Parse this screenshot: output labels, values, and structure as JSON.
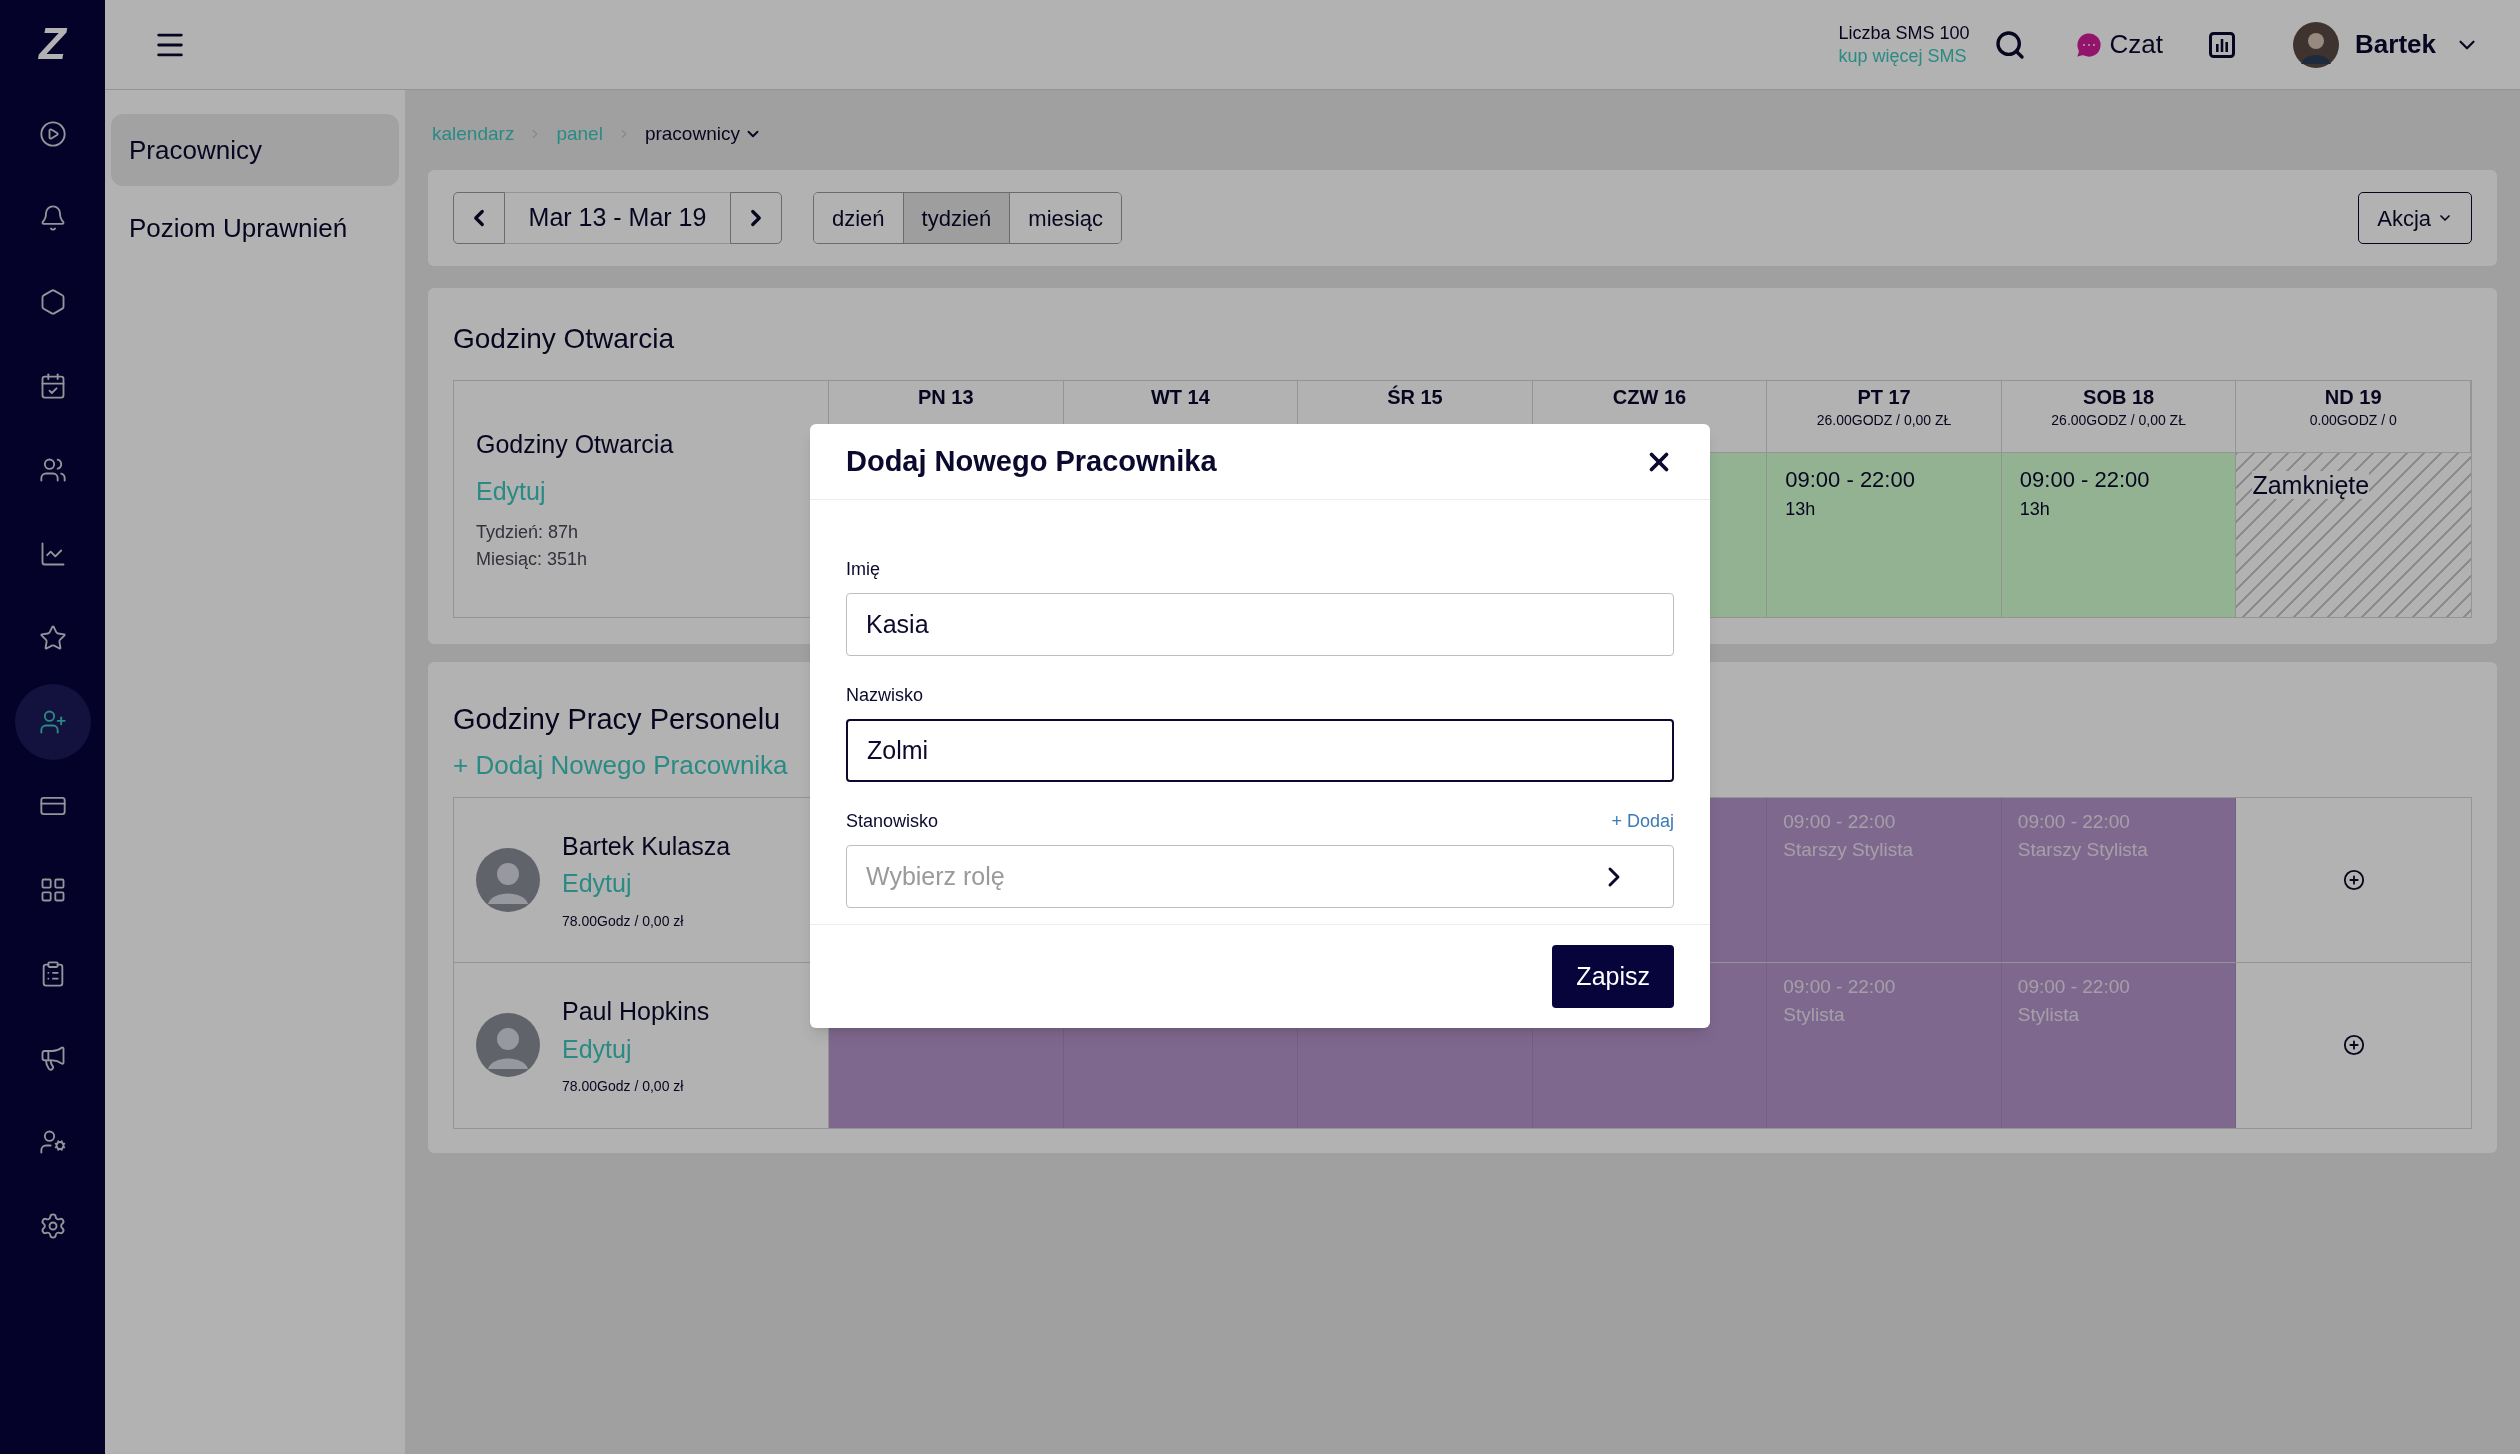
{
  "nav_rail": {
    "logo": "Z",
    "items": [
      {
        "kind": "play",
        "selected": false
      },
      {
        "kind": "bell",
        "selected": false
      },
      {
        "kind": "hexagon",
        "selected": false
      },
      {
        "kind": "calendar",
        "selected": false
      },
      {
        "kind": "users",
        "selected": false
      },
      {
        "kind": "chart",
        "selected": false
      },
      {
        "kind": "star",
        "selected": false
      },
      {
        "kind": "user-plus",
        "selected": true
      },
      {
        "kind": "card",
        "selected": false
      },
      {
        "kind": "grid",
        "selected": false
      },
      {
        "kind": "clipboard",
        "selected": false
      },
      {
        "kind": "megaphone",
        "selected": false
      },
      {
        "kind": "user-cog",
        "selected": false
      },
      {
        "kind": "settings",
        "selected": false
      }
    ]
  },
  "header": {
    "sms_count": "Liczba SMS 100",
    "buy_sms": "kup więcej SMS",
    "chat": "Czat",
    "user": "Bartek"
  },
  "subnav": {
    "items": [
      {
        "label": "Pracownicy",
        "selected": true
      },
      {
        "label": "Poziom Uprawnień",
        "selected": false
      }
    ]
  },
  "breadcrumb": [
    {
      "label": "kalendarz",
      "current": false
    },
    {
      "label": "panel",
      "current": false
    },
    {
      "label": "pracownicy",
      "current": true
    }
  ],
  "toolbar": {
    "date_range": "Mar 13 - Mar 19",
    "views": [
      {
        "label": "dzień",
        "selected": false
      },
      {
        "label": "tydzień",
        "selected": true
      },
      {
        "label": "miesiąc",
        "selected": false
      }
    ],
    "action": "Akcja"
  },
  "opening_hours": {
    "title": "Godziny Otwarcia",
    "columns": [
      {
        "day": "PN 13"
      },
      {
        "day": "WT 14"
      },
      {
        "day": "ŚR 15"
      },
      {
        "day": "CZW 16"
      },
      {
        "day": "PT 17",
        "summary": "26.00GODZ / 0,00 ZŁ"
      },
      {
        "day": "SOB 18",
        "summary": "26.00GODZ / 0,00 ZŁ"
      },
      {
        "day": "ND 19",
        "summary": "0.00GODZ / 0"
      }
    ],
    "row": {
      "label": "Godziny Otwarcia",
      "edit": "Edytuj",
      "week": "Tydzień: 87h",
      "month": "Miesiąc: 351h",
      "cells": [
        {
          "kind": "open"
        },
        {
          "kind": "open",
          "hours": "09:00 - 22:00",
          "total": "13h"
        },
        {
          "kind": "open",
          "hours": "09:00 - 22:00",
          "total": "13h"
        },
        {
          "kind": "closed",
          "label": "Zamknięte"
        }
      ]
    }
  },
  "staff": {
    "title": "Godziny Pracy Personelu",
    "add": "+ Dodaj Nowego Pracownika",
    "rows": [
      {
        "name": "Bartek Kulasza",
        "edit": "Edytuj",
        "summary": "78.00Godz / 0,00 zł",
        "cells": [
          {
            "kind": "shift"
          },
          {
            "kind": "shift",
            "hours": "09:00 - 22:00",
            "role": "Starszy Stylista"
          },
          {
            "kind": "shift",
            "hours": "09:00 - 22:00",
            "role": "Starszy Stylista"
          },
          {
            "kind": "add"
          }
        ]
      },
      {
        "name": "Paul Hopkins",
        "edit": "Edytuj",
        "summary": "78.00Godz / 0,00 zł",
        "cells": [
          {
            "kind": "shift"
          },
          {
            "kind": "shift"
          },
          {
            "kind": "shift"
          },
          {
            "kind": "shift"
          },
          {
            "kind": "shift",
            "hours": "09:00 - 22:00",
            "role": "Stylista"
          },
          {
            "kind": "shift",
            "hours": "09:00 - 22:00",
            "role": "Stylista"
          },
          {
            "kind": "add"
          }
        ]
      }
    ]
  },
  "modal": {
    "title": "Dodaj Nowego Pracownika",
    "fields": [
      {
        "kind": "text",
        "label": "Imię",
        "value": "Kasia",
        "focused": false
      },
      {
        "kind": "text",
        "label": "Nazwisko",
        "value": "Zolmi",
        "focused": true
      },
      {
        "kind": "select",
        "label": "Stanowisko",
        "action": "+ Dodaj",
        "placeholder": "Wybierz rolę"
      }
    ],
    "submit": "Zapisz"
  }
}
